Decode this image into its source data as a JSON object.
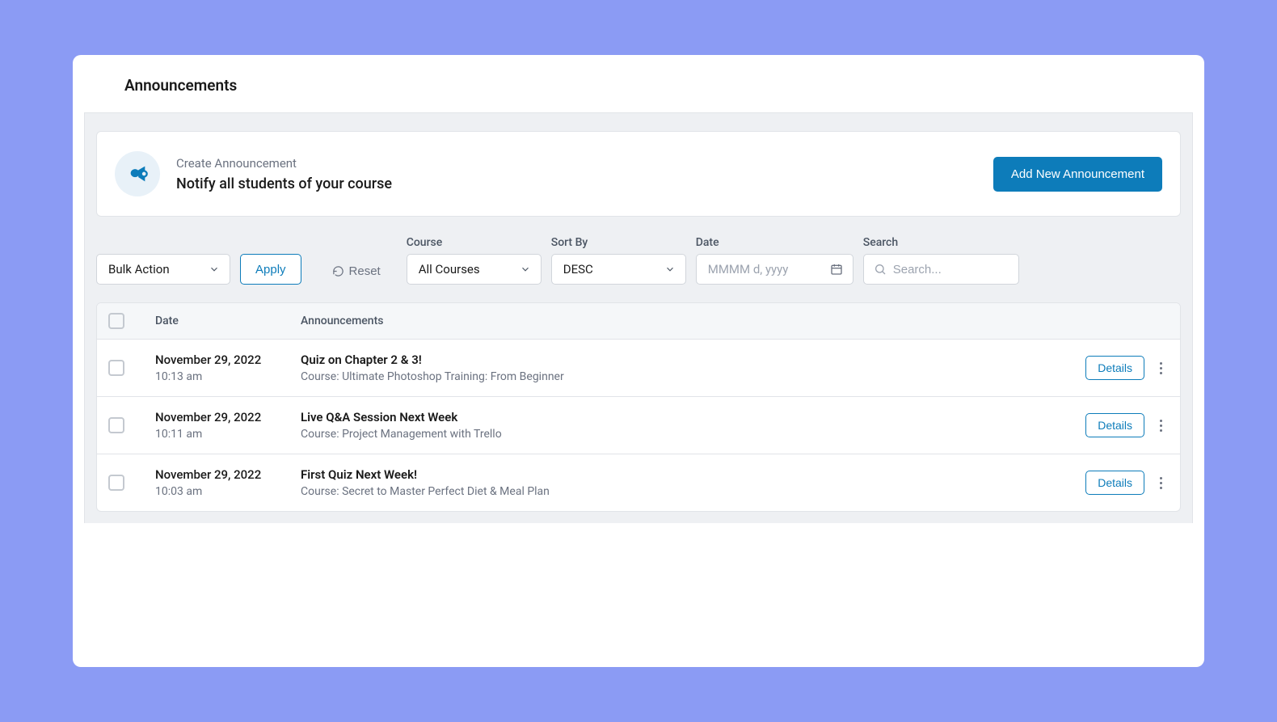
{
  "page": {
    "title": "Announcements"
  },
  "create": {
    "label": "Create Announcement",
    "subtitle": "Notify all students of your course",
    "button": "Add New Announcement"
  },
  "filters": {
    "bulk_action": {
      "value": "Bulk Action"
    },
    "apply": "Apply",
    "reset": "Reset",
    "course": {
      "label": "Course",
      "value": "All Courses"
    },
    "sort": {
      "label": "Sort By",
      "value": "DESC"
    },
    "date": {
      "label": "Date",
      "placeholder": "MMMM d, yyyy"
    },
    "search": {
      "label": "Search",
      "placeholder": "Search..."
    }
  },
  "table": {
    "columns": {
      "date": "Date",
      "announcements": "Announcements"
    },
    "details_label": "Details",
    "rows": [
      {
        "date": "November 29, 2022",
        "time": "10:13 am",
        "title": "Quiz on Chapter 2 & 3!",
        "course": "Course: Ultimate Photoshop Training: From Beginner"
      },
      {
        "date": "November 29, 2022",
        "time": "10:11 am",
        "title": "Live Q&A Session Next Week",
        "course": "Course: Project Management with Trello"
      },
      {
        "date": "November 29, 2022",
        "time": "10:03 am",
        "title": "First Quiz Next Week!",
        "course": "Course: Secret to Master Perfect Diet & Meal Plan"
      }
    ]
  }
}
